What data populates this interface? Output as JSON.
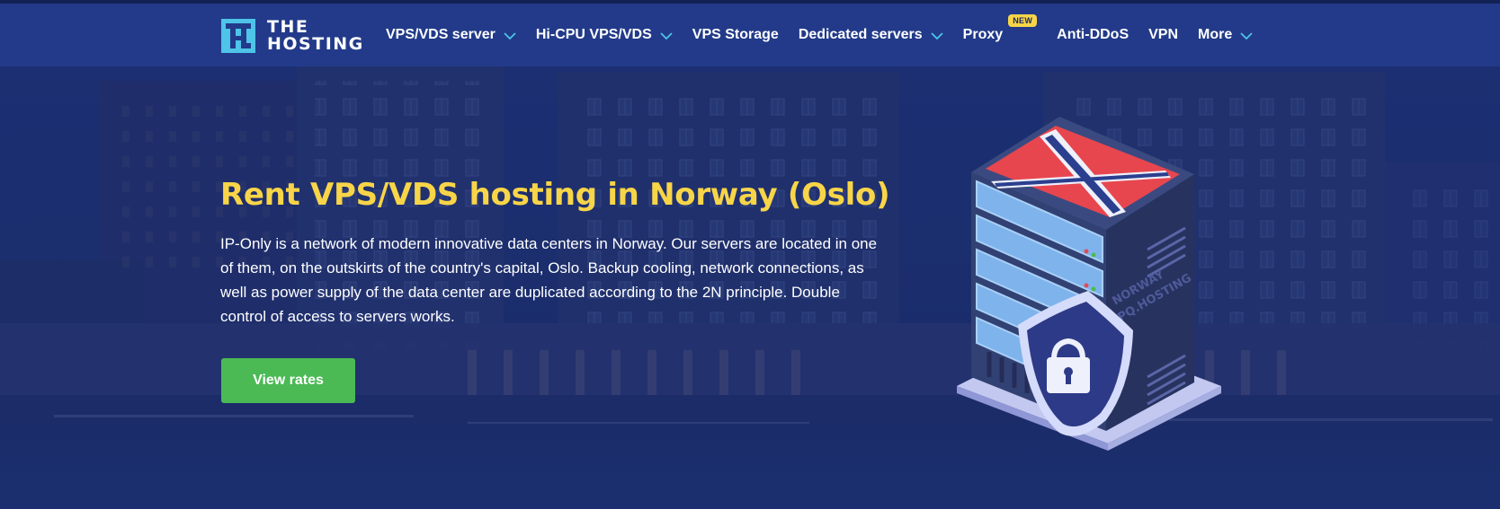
{
  "brand": {
    "logo_line1": "THE",
    "logo_line2": "HOSTING",
    "logo_icon": "th-logo-mark",
    "accent_color": "#4ec4e8"
  },
  "nav": {
    "items": [
      {
        "label": "VPS/VDS server",
        "dropdown": true
      },
      {
        "label": "Hi-CPU VPS/VDS",
        "dropdown": true
      },
      {
        "label": "VPS Storage",
        "dropdown": false
      },
      {
        "label": "Dedicated servers",
        "dropdown": true
      },
      {
        "label": "Proxy",
        "dropdown": false,
        "badge": "NEW"
      },
      {
        "label": "Anti-DDoS",
        "dropdown": false
      },
      {
        "label": "VPN",
        "dropdown": false
      },
      {
        "label": "More",
        "dropdown": true
      }
    ],
    "chevron_icon": "chevron-down-icon",
    "badge_color": "#f8d548"
  },
  "hero": {
    "title": "Rent VPS/VDS hosting in Norway (Oslo)",
    "title_color": "#f8d548",
    "description": "IP-Only is a network of modern innovative data centers in Norway. Our servers are located in one of them, on the outskirts of the country's capital, Oslo. Backup cooling, network connections, as well as power supply of the data center are duplicated according to the 2N principle. Double control of access to servers works.",
    "cta_label": "View rates",
    "cta_color": "#4bba55"
  },
  "illustration": {
    "server_label_line1": "NORWAY",
    "server_label_line2": "PQ.HOSTING",
    "icons": [
      "norway-flag-icon",
      "server-rack-icon",
      "shield-lock-icon"
    ]
  },
  "colors": {
    "background": "#1b2d6e",
    "header": "#223a8a"
  }
}
